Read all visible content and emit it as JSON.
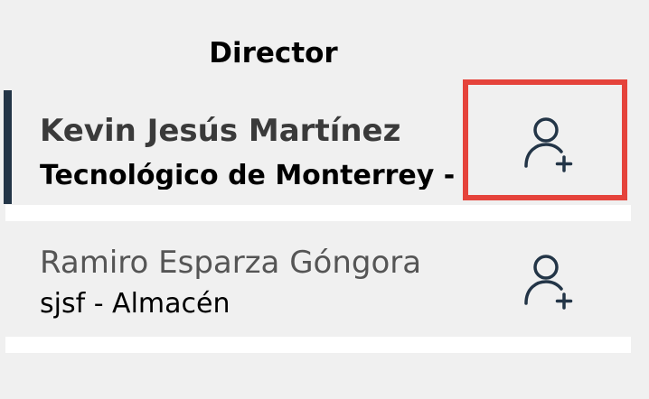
{
  "section": {
    "title": "Director"
  },
  "people": [
    {
      "name": "Kevin Jesús Martínez",
      "subtitle": "Tecnológico de Monterrey - ",
      "selected": true,
      "action_icon": "add-user-icon"
    },
    {
      "name": "Ramiro Esparza Góngora",
      "subtitle": "sjsf - Almacén",
      "selected": false,
      "action_icon": "add-user-icon"
    }
  ],
  "colors": {
    "background": "#f0f0f0",
    "divider": "#ffffff",
    "selection_bar": "#233547",
    "icon": "#233547",
    "highlight": "#e5433b"
  }
}
